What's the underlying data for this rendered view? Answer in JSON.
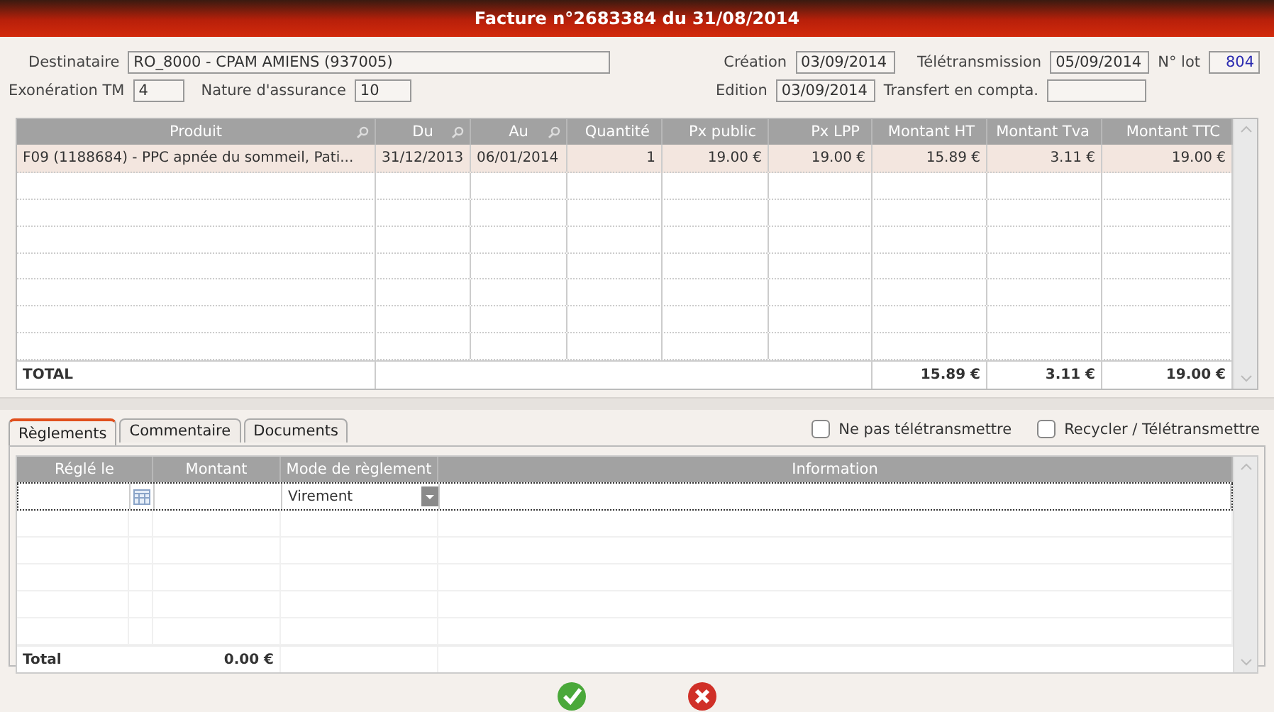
{
  "window": {
    "title": "Facture n°2683384 du 31/08/2014"
  },
  "header": {
    "left": [
      {
        "label": "Destinataire",
        "value": "RO_8000 - CPAM AMIENS (937005)"
      },
      {
        "label": "Exonération TM",
        "value": "4"
      },
      {
        "label": "Nature d'assurance",
        "value": "10"
      }
    ],
    "right": [
      {
        "label": "Création",
        "value": "03/09/2014"
      },
      {
        "label": "Télétransmission",
        "value": "05/09/2014"
      },
      {
        "label": "N° lot",
        "value": "804"
      },
      {
        "label": "Edition",
        "value": "03/09/2014"
      },
      {
        "label": "Transfert en compta."
      }
    ]
  },
  "products": {
    "columns": [
      {
        "label": "Produit",
        "filterable": true
      },
      {
        "label": "Du",
        "filterable": true
      },
      {
        "label": "Au",
        "filterable": true
      },
      {
        "label": "Quantité",
        "filterable": false
      },
      {
        "label": "Px public",
        "filterable": false
      },
      {
        "label": "Px LPP",
        "filterable": false
      },
      {
        "label": "Montant HT",
        "filterable": false
      },
      {
        "label": "Montant Tva",
        "filterable": false
      },
      {
        "label": "Montant TTC",
        "filterable": false
      }
    ],
    "rows": [
      {
        "selected": true,
        "cells": [
          "F09 (1188684) - PPC apnée du sommeil, Pati...",
          "31/12/2013",
          "06/01/2014",
          "1",
          "19.00 €",
          "19.00 €",
          "15.89 €",
          "3.11 €",
          "19.00 €"
        ]
      }
    ],
    "total": {
      "label": "TOTAL",
      "cells": [
        "",
        "",
        "",
        "",
        "",
        "15.89 €",
        "3.11 €",
        "19.00 €"
      ]
    }
  },
  "tabs": [
    {
      "label": "Règlements",
      "selected": true
    },
    {
      "label": "Commentaire",
      "selected": false
    },
    {
      "label": "Documents",
      "selected": false
    }
  ],
  "options": [
    {
      "label": "Ne pas télétransmettre",
      "checked": false
    },
    {
      "label": "Recycler / Télétransmettre",
      "checked": false
    }
  ],
  "payments": {
    "columns": [
      "Réglé le",
      "Montant",
      "Mode de règlement",
      "Information"
    ],
    "rows": [
      {
        "date": "",
        "amount": "",
        "mode": "Virement",
        "information": ""
      }
    ],
    "total": {
      "label": "Total",
      "amount": "0.00 €"
    }
  },
  "buttons": [
    {
      "kind": "confirm"
    },
    {
      "kind": "cancel"
    }
  ]
}
